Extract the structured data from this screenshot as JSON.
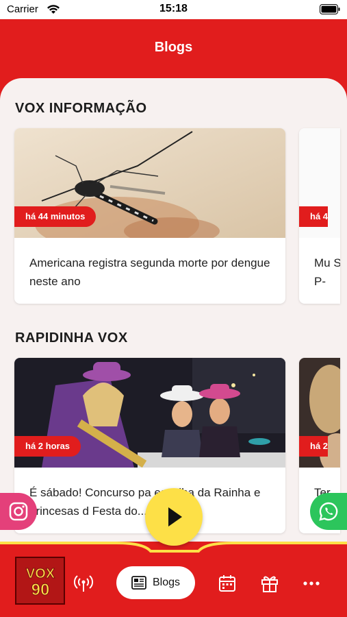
{
  "status_bar": {
    "carrier": "Carrier",
    "time": "15:18"
  },
  "header": {
    "title": "Blogs"
  },
  "sections": [
    {
      "title": "VOX INFORMAÇÃO",
      "cards": [
        {
          "badge": "há 44 minutos",
          "title": "Americana registra segunda morte por dengue neste ano"
        }
      ],
      "next_card_preview": {
        "badge": "há 4",
        "text": "Mu SP-"
      }
    },
    {
      "title": "RAPIDINHA VOX",
      "cards": [
        {
          "badge": "há 2 horas",
          "title": "É sábado! Concurso pa escolha da Rainha e princesas d Festa do..."
        }
      ],
      "next_card_preview": {
        "badge": "há 2",
        "text": "Ter"
      }
    }
  ],
  "player": {
    "logo_text_top": "VOX",
    "logo_text_bottom": "90",
    "active_tab_label": "Blogs"
  },
  "colors": {
    "brand_red": "#e11d1d",
    "play_yellow": "#fde047",
    "instagram": "#e4407a",
    "whatsapp": "#2cc55c"
  },
  "icons": [
    "wifi-icon",
    "battery-icon",
    "instagram-icon",
    "whatsapp-icon",
    "play-icon",
    "radio-icon",
    "newspaper-icon",
    "calendar-icon",
    "gift-icon",
    "more-icon"
  ]
}
